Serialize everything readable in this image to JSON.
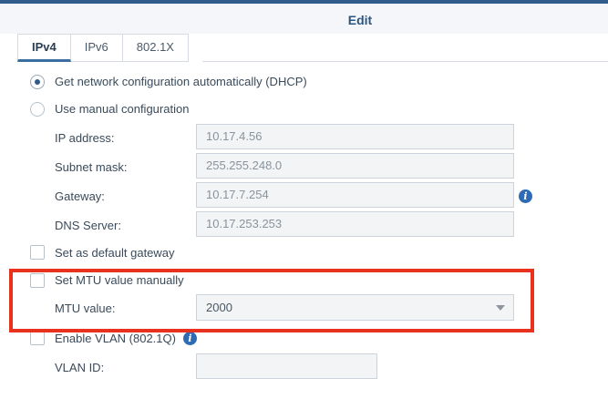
{
  "window": {
    "title": "Edit",
    "accent_color": "#2f5c8a",
    "highlight_color": "#e8321e"
  },
  "tabs": [
    {
      "label": "IPv4",
      "active": true
    },
    {
      "label": "IPv6",
      "active": false
    },
    {
      "label": "802.1X",
      "active": false
    }
  ],
  "ipv4": {
    "dhcp_option": {
      "label": "Get network configuration automatically (DHCP)",
      "selected": true
    },
    "manual_option": {
      "label": "Use manual configuration",
      "selected": false
    },
    "ip_address": {
      "label": "IP address:",
      "value": "10.17.4.56"
    },
    "subnet_mask": {
      "label": "Subnet mask:",
      "value": "255.255.248.0"
    },
    "gateway": {
      "label": "Gateway:",
      "value": "10.17.7.254",
      "info_icon": "info-icon"
    },
    "dns_server": {
      "label": "DNS Server:",
      "value": "10.17.253.253"
    },
    "default_gateway": {
      "label": "Set as default gateway",
      "checked": false
    },
    "mtu_manual": {
      "label": "Set MTU value manually",
      "checked": false
    },
    "mtu_value": {
      "label": "MTU value:",
      "value": "2000"
    },
    "vlan": {
      "label": "Enable VLAN (802.1Q)",
      "checked": false,
      "info_icon": "info-icon"
    },
    "vlan_id": {
      "label": "VLAN ID:",
      "value": ""
    }
  }
}
